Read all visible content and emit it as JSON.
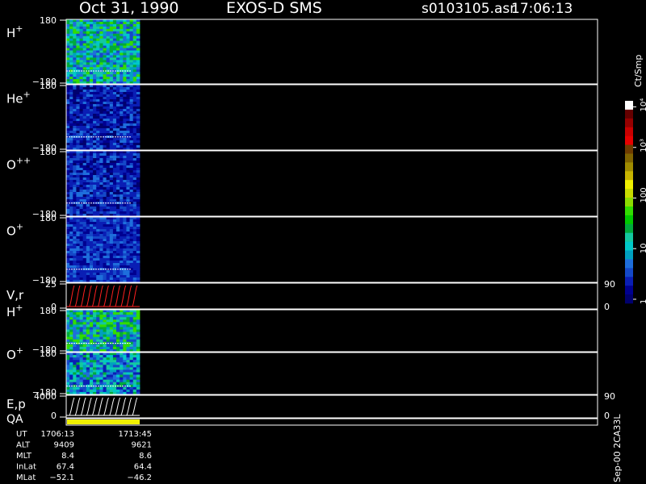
{
  "header": {
    "date": "Oct 31, 1990",
    "instrument": "EXOS-D SMS",
    "file": "s0103105.asr",
    "time": "17:06:13"
  },
  "panels": [
    {
      "id": "p1",
      "label": "H",
      "sup": "+",
      "top_tick": "180",
      "bot_tick": "−180",
      "kind": "spec",
      "palette": "hplus1"
    },
    {
      "id": "p2",
      "label": "He",
      "sup": "+",
      "top_tick": "180",
      "bot_tick": "−180",
      "kind": "spec",
      "palette": "heplus"
    },
    {
      "id": "p3",
      "label": "O",
      "sup": "++",
      "top_tick": "180",
      "bot_tick": "−180",
      "kind": "spec",
      "palette": "oplusplus"
    },
    {
      "id": "p4",
      "label": "O",
      "sup": "+",
      "top_tick": "180",
      "bot_tick": "−180",
      "kind": "spec",
      "palette": "oplus"
    },
    {
      "id": "p5",
      "label": "V,r",
      "sup": "",
      "top_tick": "25",
      "bot_tick": "0",
      "kind": "vr",
      "right_top": "90",
      "right_bot": "0"
    },
    {
      "id": "p6",
      "label": "H",
      "sup": "+",
      "top_tick": "180",
      "bot_tick": "−180",
      "kind": "spec",
      "palette": "hplus2"
    },
    {
      "id": "p7",
      "label": "O",
      "sup": "+",
      "top_tick": "180",
      "bot_tick": "−180",
      "kind": "spec",
      "palette": "oplus2"
    },
    {
      "id": "p8",
      "label": "E,p",
      "sup": "",
      "top_tick": "4000",
      "bot_tick": "0",
      "kind": "ep",
      "right_top": "90",
      "right_bot": "0"
    }
  ],
  "qa": {
    "label": "QA",
    "color": "#f0f000"
  },
  "colorbar": {
    "unit": "Ct/Smp",
    "ticks": [
      "1",
      "10",
      "100",
      "10³",
      "10⁴"
    ],
    "colors": [
      "#00006e",
      "#000090",
      "#0a1eb4",
      "#1448c8",
      "#1e6edc",
      "#00a0c0",
      "#00c8c8",
      "#14c8a0",
      "#00aa3c",
      "#00c800",
      "#32dc00",
      "#8cdc00",
      "#c8dc00",
      "#f0f000",
      "#c8b400",
      "#a08c00",
      "#806400",
      "#6e3c00",
      "#e60000",
      "#c80000",
      "#960000",
      "#640000",
      "#ffffff"
    ]
  },
  "footer": {
    "rows": [
      {
        "label": "UT",
        "v1": "1706:13",
        "v2": "1713:45"
      },
      {
        "label": "ALT",
        "v1": "9409",
        "v2": "9621"
      },
      {
        "label": "MLT",
        "v1": "8.4",
        "v2": "8.6"
      },
      {
        "label": "InLat",
        "v1": "67.4",
        "v2": "64.4"
      },
      {
        "label": "MLat",
        "v1": "−52.1",
        "v2": "−46.2"
      }
    ],
    "version": "Sep-00 2CA33L"
  }
}
